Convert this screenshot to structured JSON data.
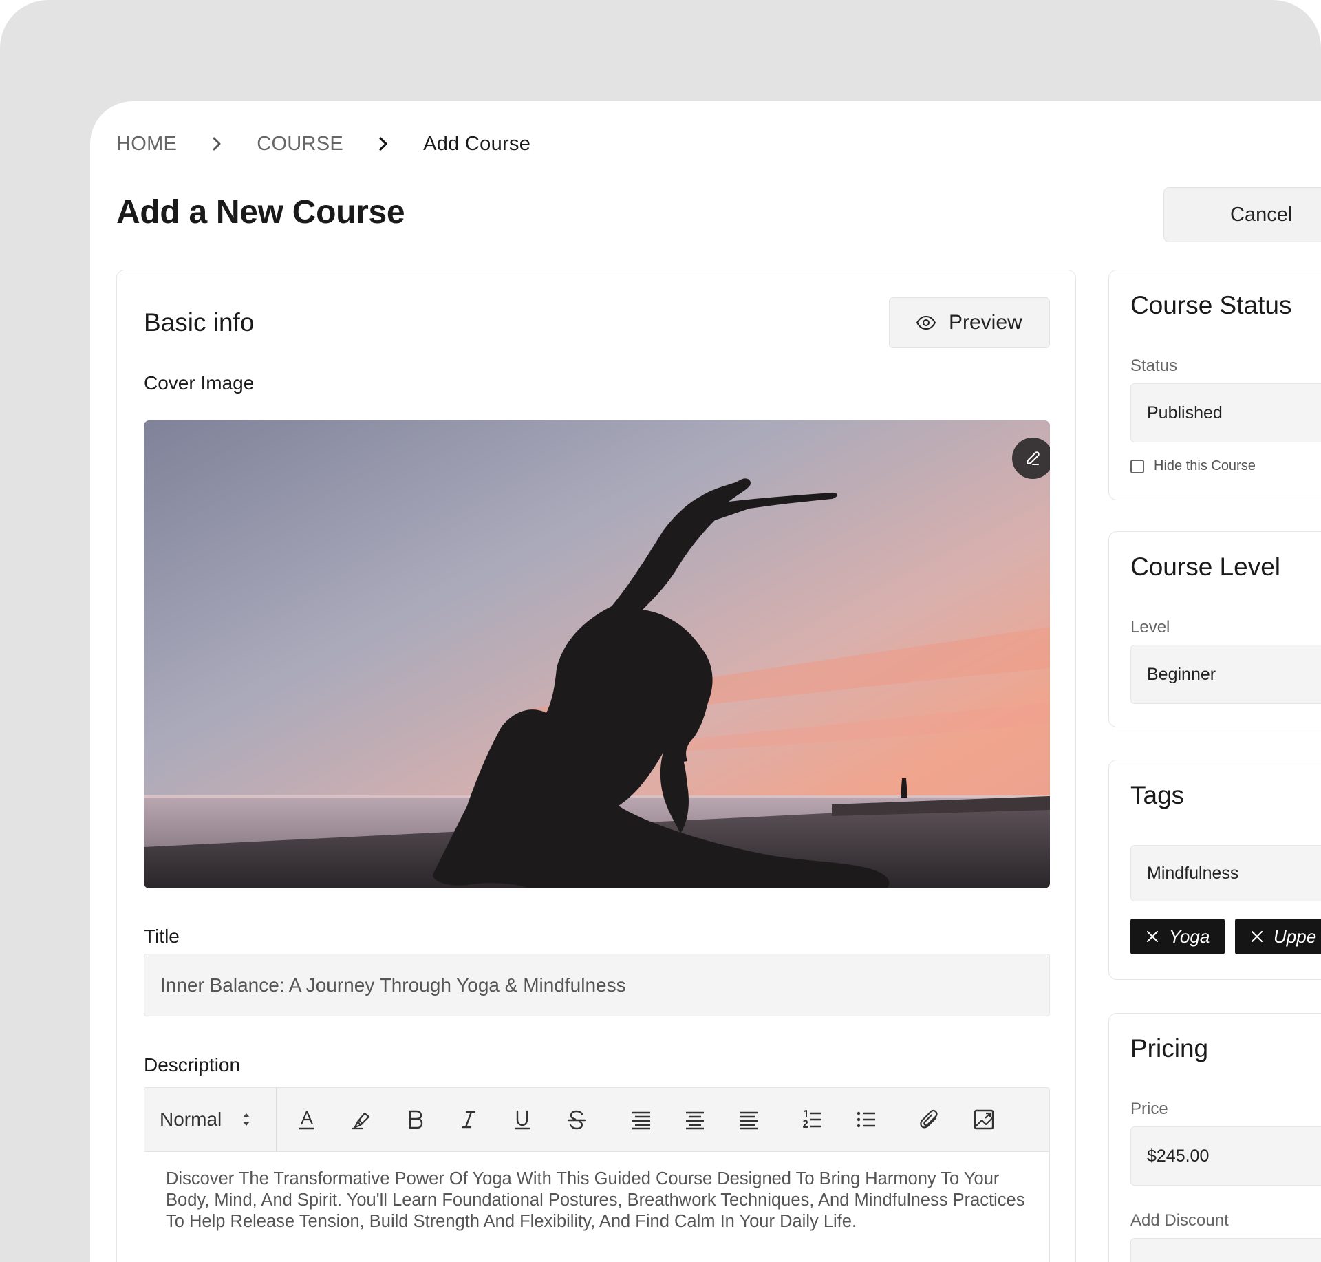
{
  "breadcrumb": [
    "HOME",
    "COURSE",
    "Add Course"
  ],
  "page": {
    "title": "Add a New Course",
    "cancel_label": "Cancel"
  },
  "basic_info": {
    "heading": "Basic info",
    "preview_label": "Preview",
    "cover_image_label": "Cover Image",
    "title_label": "Title",
    "title_value": "Inner Balance: A Journey Through Yoga & Mindfulness",
    "description_label": "Description",
    "editor": {
      "style_value": "Normal",
      "tools": [
        "text-color-icon",
        "highlight-icon",
        "bold-icon",
        "italic-icon",
        "underline-icon",
        "strikethrough-icon",
        "align-left-icon",
        "align-center-icon",
        "align-right-icon",
        "ordered-list-icon",
        "bullet-list-icon",
        "attach-icon",
        "insert-image-icon"
      ],
      "content": "Discover The Transformative Power Of Yoga With This Guided Course Designed To Bring Harmony To Your Body, Mind, And Spirit. You'll Learn Foundational Postures, Breathwork Techniques, And Mindfulness Practices To Help Release Tension, Build Strength And Flexibility, And Find Calm In Your Daily Life."
    }
  },
  "course_status": {
    "heading": "Course Status",
    "status_label": "Status",
    "status_value": "Published",
    "hide_label": "Hide this Course",
    "hide_checked": false
  },
  "course_level": {
    "heading": "Course Level",
    "level_label": "Level",
    "level_value": "Beginner"
  },
  "tags": {
    "heading": "Tags",
    "input_value": "Mindfulness",
    "chips": [
      "Yoga",
      "Uppe"
    ]
  },
  "pricing": {
    "heading": "Pricing",
    "price_label": "Price",
    "price_value": "$245.00",
    "discount_label": "Add Discount"
  },
  "colors": {
    "page_bg": "#e3e3e3",
    "surface": "#ffffff",
    "input_bg": "#f4f4f4",
    "chip_bg": "#151515",
    "text": "#1a1a1a",
    "muted": "#666666"
  }
}
